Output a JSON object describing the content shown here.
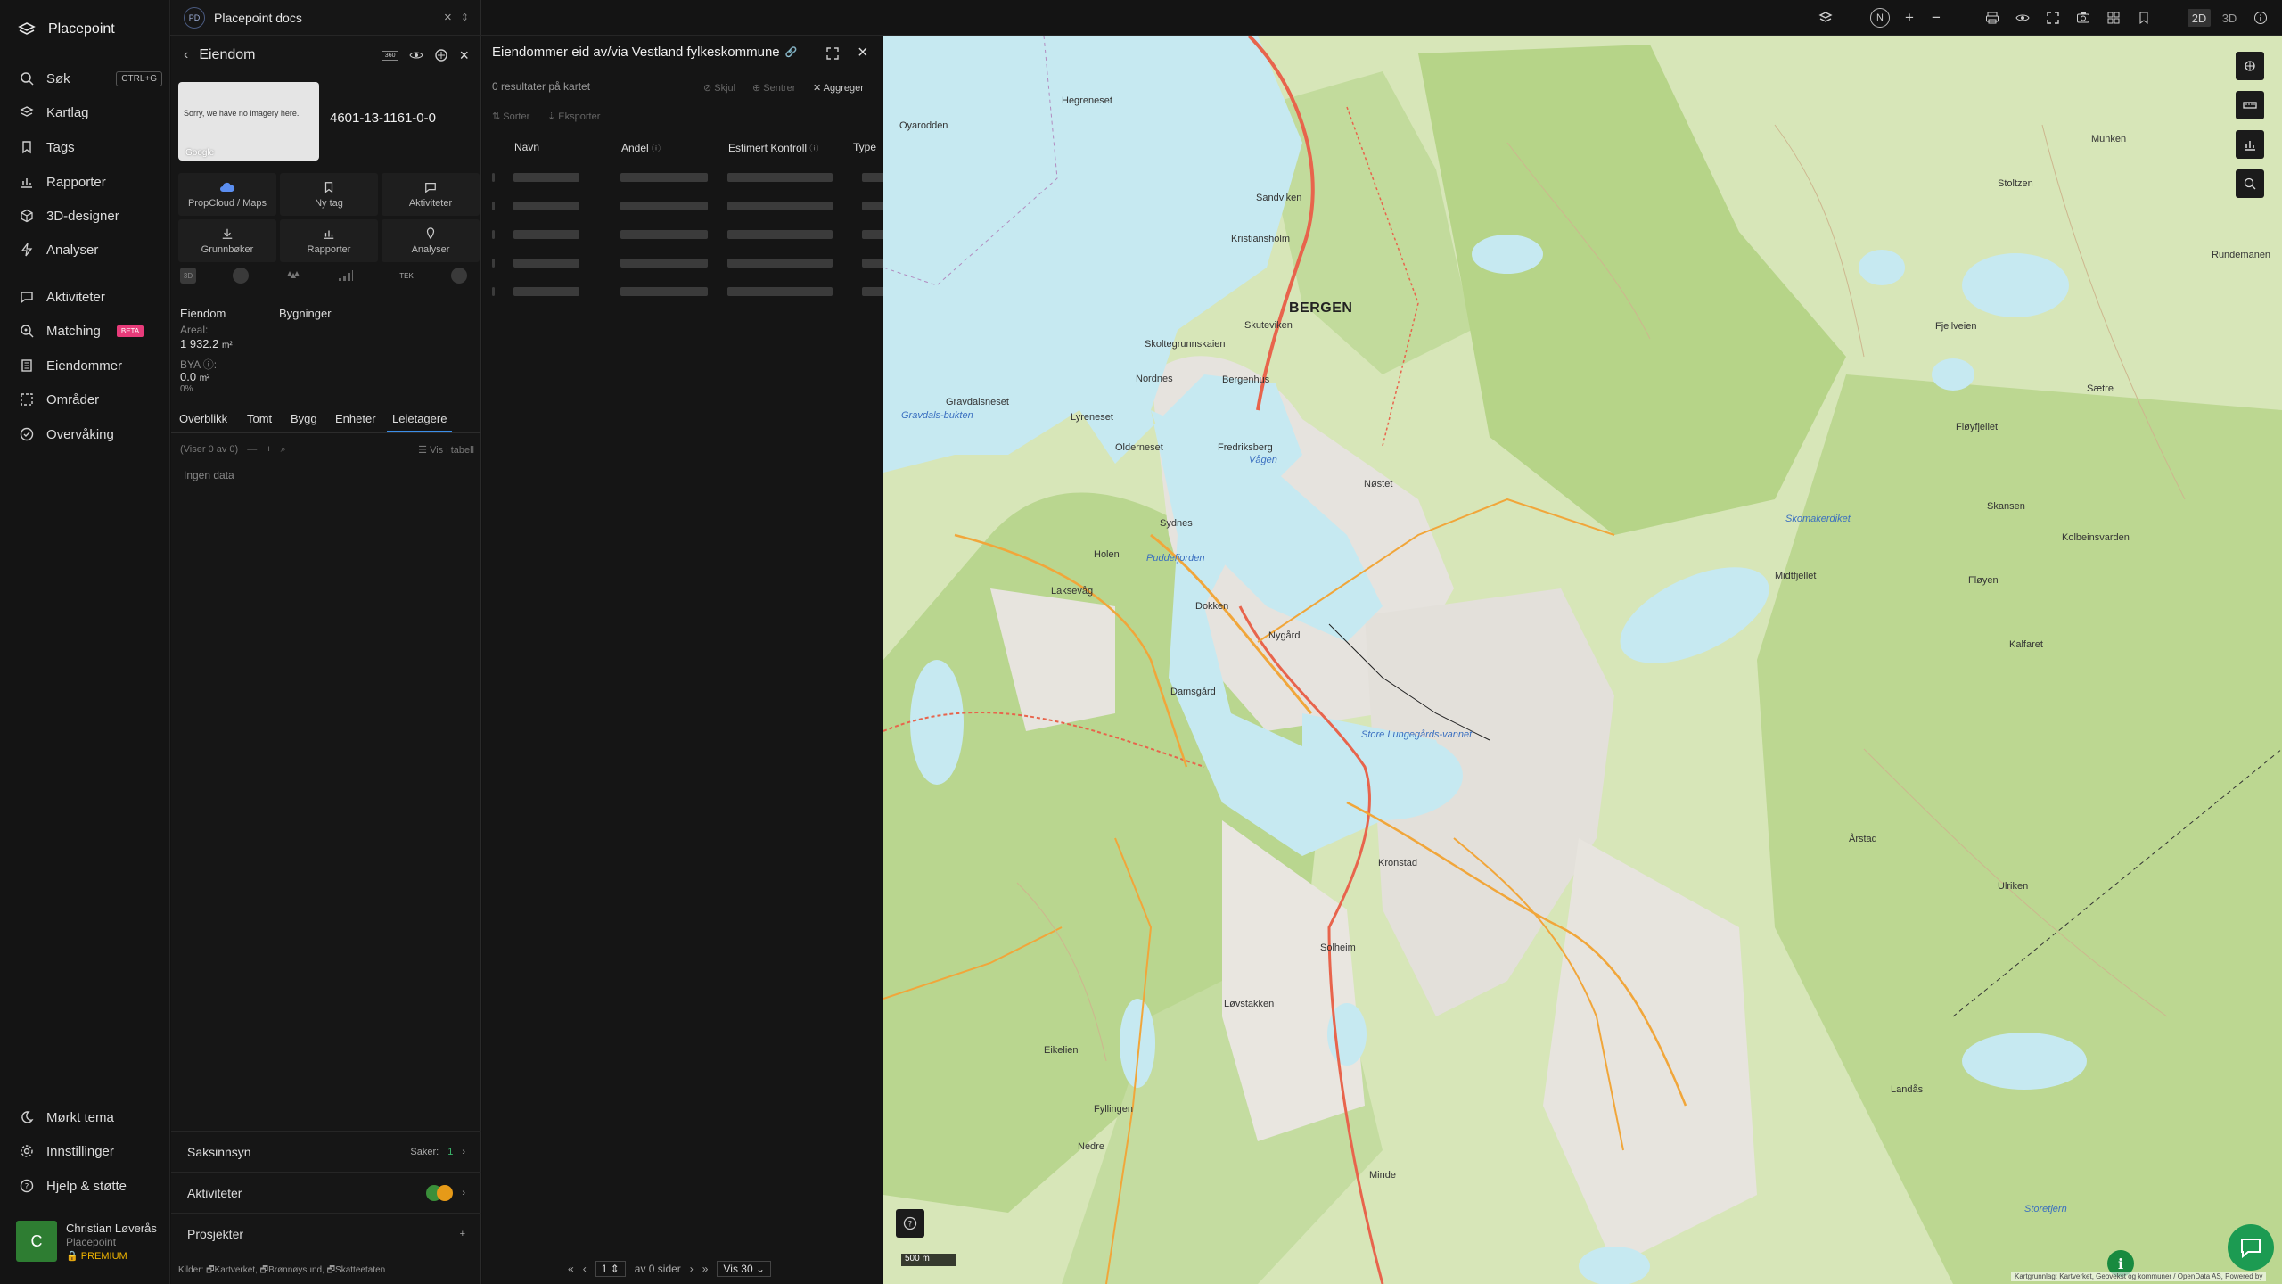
{
  "nav": {
    "brand": "Placepoint",
    "items": [
      {
        "label": "Søk",
        "icon": "search-icon",
        "shortcut": "CTRL+G"
      },
      {
        "label": "Kartlag",
        "icon": "layers-icon"
      },
      {
        "label": "Tags",
        "icon": "bookmark-icon"
      },
      {
        "label": "Rapporter",
        "icon": "chart-icon"
      },
      {
        "label": "3D-designer",
        "icon": "cube-icon"
      },
      {
        "label": "Analyser",
        "icon": "bolt-icon"
      },
      {
        "label": "Aktiviteter",
        "icon": "message-icon"
      },
      {
        "label": "Matching",
        "icon": "match-icon",
        "badge": "BETA"
      },
      {
        "label": "Eiendommer",
        "icon": "building-icon"
      },
      {
        "label": "Områder",
        "icon": "area-icon"
      },
      {
        "label": "Overvåking",
        "icon": "monitor-icon"
      }
    ],
    "footer": [
      {
        "label": "Mørkt tema",
        "icon": "moon-icon"
      },
      {
        "label": "Innstillinger",
        "icon": "gear-icon"
      },
      {
        "label": "Hjelp & støtte",
        "icon": "help-icon"
      }
    ],
    "user": {
      "initial": "C",
      "name": "Christian Løverås",
      "org": "Placepoint",
      "tier": "PREMIUM"
    }
  },
  "docs": {
    "badge": "PD",
    "title": "Placepoint docs"
  },
  "property": {
    "header": "Eiendom",
    "imagery_text": "Sorry, we have no imagery here.",
    "imagery_credit": "Google",
    "parcel_id": "4601-13-1161-0-0",
    "tiles": [
      {
        "label": "PropCloud / Maps",
        "icon": "cloud-icon"
      },
      {
        "label": "Ny tag",
        "icon": "bookmark-icon"
      },
      {
        "label": "Aktiviteter",
        "icon": "message-icon"
      },
      {
        "label": "Grunnbøker",
        "icon": "download-icon"
      },
      {
        "label": "Rapporter",
        "icon": "chart-icon"
      },
      {
        "label": "Analyser",
        "icon": "bolt-icon"
      }
    ],
    "chips": [
      "3D",
      "",
      "",
      "",
      "TEK",
      ""
    ],
    "subtabs": [
      "Eiendom",
      "Bygninger"
    ],
    "area_label": "Areal:",
    "area_value": "1 932.2",
    "area_unit": "m²",
    "bya_label": "BYA",
    "bya_value": "0.0",
    "bya_unit": "m²",
    "bya_pct": "0%",
    "tabs": [
      "Overblikk",
      "Tomt",
      "Bygg",
      "Enheter",
      "Leietagere"
    ],
    "active_tab": "Leietagere",
    "list_count": "(Viser 0 av 0)",
    "list_view": "Vis i tabell",
    "empty": "Ingen data",
    "sections": [
      {
        "label": "Saksinnsyn",
        "meta": "Saker:",
        "count": "1"
      },
      {
        "label": "Aktiviteter"
      },
      {
        "label": "Prosjekter"
      }
    ],
    "sources_label": "Kilder:",
    "sources": [
      "Kartverket,",
      "Brønnøysund,",
      "Skatteetaten"
    ]
  },
  "results": {
    "title": "Eiendommer eid av/via Vestland fylkeskommune",
    "count": "0 resultater på kartet",
    "actions": [
      "Skjul",
      "Sentrer",
      "Aggreger"
    ],
    "toolbar": [
      "Sorter",
      "Eksporter"
    ],
    "columns": [
      "Navn",
      "Andel",
      "Estimert Kontroll",
      "Type"
    ],
    "page": "1",
    "page_of": "av 0 sider",
    "page_size": "Vis 30"
  },
  "map": {
    "view_modes": [
      "2D",
      "3D"
    ],
    "compass": "N",
    "city": "BERGEN",
    "scale": "500 m",
    "attribution": "Kartgrunnlag: Kartverket, Geovekst og kommuner / OpenData AS, Powered by",
    "places": [
      "Hegreneset",
      "Oyarodden",
      "Sandviken",
      "Kristiansholm",
      "Skuteviken",
      "Skoltegrunnskaien",
      "Nordnes",
      "Bergenhus",
      "Fredriksberg",
      "Nøstet",
      "Sydnes",
      "Dokken",
      "Nygård",
      "Gravdalsneset",
      "Lyreneset",
      "Olderneset",
      "Damsgård",
      "Laksevåg",
      "Holen",
      "Eikelien",
      "Solheim",
      "Kronstad",
      "Minde",
      "Landås",
      "Fløyen",
      "Fløyfjellet",
      "Skansen",
      "Kalfaret",
      "Årstad",
      "Løvstakken",
      "Fyllingen",
      "Nedre",
      "Kolbeinsvarden",
      "Ulriken",
      "Sætre",
      "Munken",
      "Rundemanen",
      "Midtfjellet",
      "Stoltzen",
      "Fjellveien"
    ],
    "waters": [
      "Puddefjorden",
      "Store Lungegårds-vannet",
      "Skomakerdiket",
      "Gravdals-bukten",
      "Vågen",
      "Storetjern"
    ]
  }
}
